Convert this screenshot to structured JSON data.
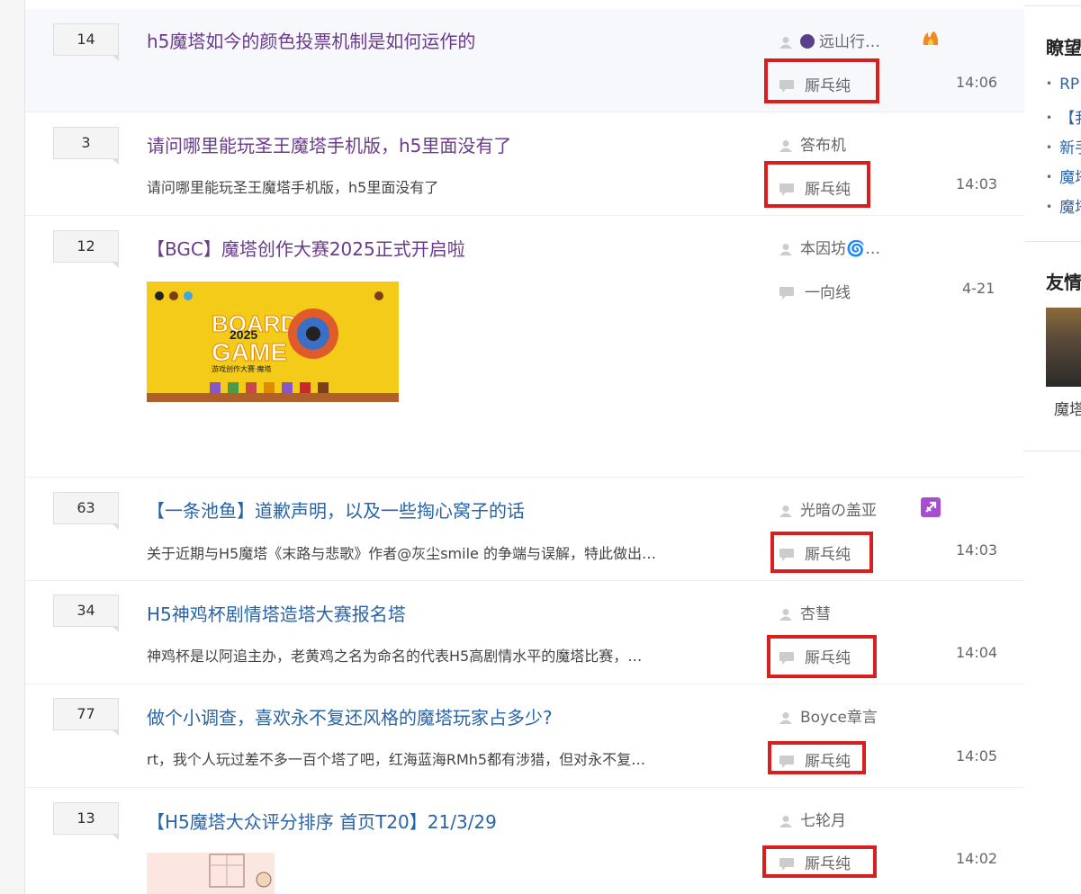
{
  "threads": [
    {
      "count": "14",
      "title": "h5魔塔如今的颜色投票机制是如何运作的",
      "excerpt": "",
      "author": "远山行…",
      "last_poster": "厮乓纯",
      "time": "14:06",
      "title_style": "visited"
    },
    {
      "count": "3",
      "title": "请问哪里能玩圣王魔塔手机版，h5里面没有了",
      "excerpt": "请问哪里能玩圣王魔塔手机版，h5里面没有了",
      "author": "答布机",
      "last_poster": "厮乓纯",
      "time": "14:03",
      "title_style": "visited"
    },
    {
      "count": "12",
      "title": "【BGC】魔塔创作大赛2025正式开启啦",
      "excerpt": "",
      "author": "本因坊🌀…",
      "last_poster": "一向线",
      "time": "4-21",
      "title_style": "visited",
      "image_text": {
        "line1": "BOARD",
        "line2": "2025",
        "line3": "GAME",
        "line4": "游戏创作大赛·魔塔"
      }
    },
    {
      "count": "63",
      "title": "【一条池鱼】道歉声明，以及一些掏心窝子的话",
      "excerpt": "关于近期与H5魔塔《末路与悲歌》作者@灰尘smile 的争端与误解，特此做出…",
      "author": "光暗の盖亚",
      "last_poster": "厮乓纯",
      "time": "14:03",
      "title_style": "link"
    },
    {
      "count": "34",
      "title": "H5神鸡杯剧情塔造塔大赛报名塔",
      "excerpt": "神鸡杯是以阿追主办，老黄鸡之名为命名的代表H5高剧情水平的魔塔比赛，…",
      "author": "杏彗",
      "last_poster": "厮乓纯",
      "time": "14:04",
      "title_style": "link"
    },
    {
      "count": "77",
      "title": "做个小调查，喜欢永不复还风格的魔塔玩家占多少?",
      "excerpt": "rt，我个人玩过差不多一百个塔了吧，红海蓝海RMh5都有涉猎，但对永不复…",
      "author": "Boyce章言",
      "last_poster": "厮乓纯",
      "time": "14:05",
      "title_style": "link"
    },
    {
      "count": "13",
      "title": "【H5魔塔大众评分排序 首页T20】21/3/29",
      "excerpt": "",
      "author": "七轮月",
      "last_poster": "厮乓纯",
      "time": "14:02",
      "title_style": "link"
    }
  ],
  "sidebar": {
    "heading1": "瞭望",
    "items": [
      "RP",
      "【我",
      "新手",
      "魔塔",
      "魔塔"
    ],
    "heading2": "友情",
    "card_caption": "魔塔"
  },
  "colors": {
    "highlight_box": "#d71f1f",
    "visited_link": "#6a3a8c",
    "link": "#2a64a8"
  }
}
